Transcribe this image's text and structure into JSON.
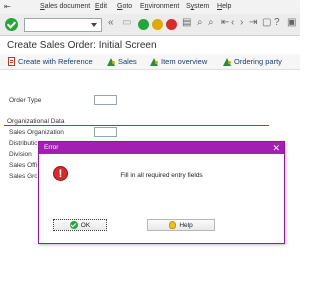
{
  "menu": {
    "items": [
      "Sales document",
      "Edit",
      "Goto",
      "Environment",
      "System",
      "Help"
    ],
    "underline_first": [
      "S",
      "E",
      "G",
      "n",
      "y",
      "H"
    ]
  },
  "toolbar": {
    "command_field_value": "",
    "icons": [
      "enter-icon",
      "back-icon",
      "exit-icon",
      "cancel-icon",
      "print-icon",
      "find-icon",
      "find-next-icon",
      "first-page-icon",
      "previous-page-icon",
      "next-page-icon",
      "last-page-icon",
      "new-session-icon",
      "shortcut-icon",
      "help-icon",
      "customize-icon"
    ]
  },
  "title": "Create Sales Order: Initial Screen",
  "app_toolbar": {
    "create_with_reference": "Create with Reference",
    "sales": "Sales",
    "item_overview": "Item overview",
    "ordering_party": "Ordering party"
  },
  "form": {
    "order_type_label": "Order Type",
    "order_type_value": "",
    "org_section_title": "Organizational Data",
    "sales_org_label": "Sales Organization",
    "dist_channel_label": "Distribution Channel",
    "division_label": "Division",
    "sales_office_label": "Sales Office",
    "sales_group_label": "Sales Group"
  },
  "dialog": {
    "title": "Error",
    "message": "Fill in all required entry fields",
    "ok_label": "OK",
    "help_label": "Help"
  },
  "colors": {
    "dialog_title_bg": "#a31eb3",
    "section_line": "#7b3f9e",
    "link_text": "#1a3f73"
  }
}
